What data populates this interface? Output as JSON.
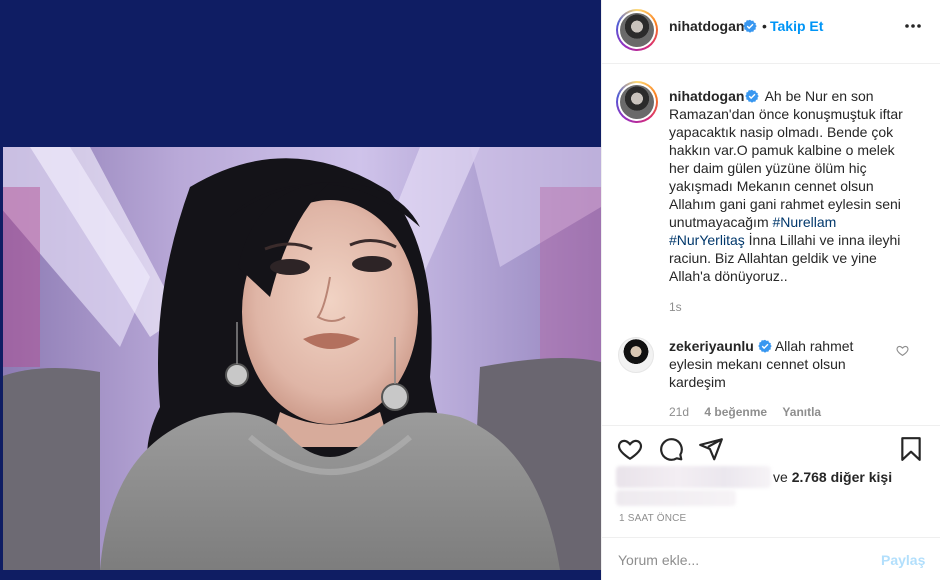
{
  "header": {
    "username": "nihatdogan",
    "separator": "•",
    "follow_label": "Takip Et"
  },
  "caption": {
    "username": "nihatdogan",
    "text_before": "Ah be Nur en son Ramazan'dan önce konuşmuştuk iftar yapacaktık nasip olmadı. Bende çok hakkın var.O pamuk kalbine o melek her daim gülen yüzüne ölüm hiç yakışmadı Mekanın cennet olsun Allahım gani gani rahmet eylesin seni unutmayacağım",
    "hashtag1": "#Nurellam",
    "hashtag2": "#NurYerlitaş",
    "text_after": "İnna Lillahi ve inna ileyhi raciun. Biz Allahtan geldik ve yine Allah'a dönüyoruz..",
    "time": "1s"
  },
  "comment": {
    "username": "zekeriyaunlu",
    "text": "Allah rahmet eylesin mekanı cennet olsun kardeşim",
    "time": "21d",
    "likes": "4 beğenme",
    "reply_label": "Yanıtla"
  },
  "likes": {
    "suffix": "ve",
    "count": "2.768 diğer kişi"
  },
  "post_time": "1 SAAT ÖNCE",
  "add_comment": {
    "placeholder": "Yorum ekle...",
    "share_label": "Paylaş"
  },
  "colors": {
    "accent": "#0095f6",
    "hashtag": "#00376b",
    "media_background": "#0f1d63",
    "share_disabled": "#b2dffc"
  },
  "icons": [
    "more-icon",
    "verified-icon",
    "heart-icon",
    "comment-icon",
    "share-icon",
    "bookmark-icon"
  ]
}
